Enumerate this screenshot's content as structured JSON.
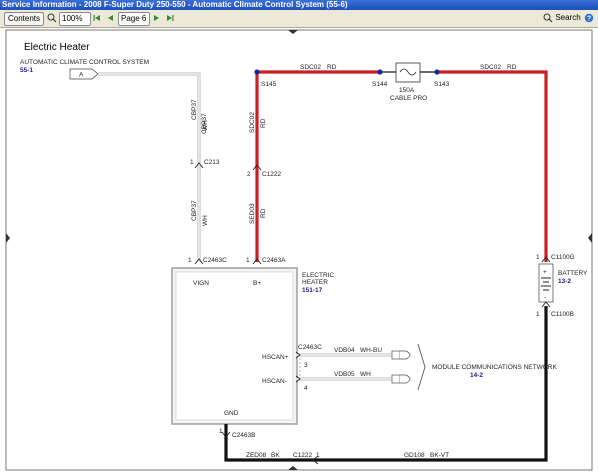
{
  "window": {
    "title": "Service Information - 2008 F-Super Duty 250-550 - Automatic Climate Control System (55-6)"
  },
  "toolbar": {
    "contents_label": "Contents",
    "zoom_value": "100%",
    "page_value": "Page 6",
    "search_label": "Search"
  },
  "diagram": {
    "title": "Electric Heater",
    "acc_system": {
      "name": "AUTOMATIC CLIMATE CONTROL SYSTEM",
      "ref": "55-1",
      "connector": "A"
    },
    "heater": {
      "name_line1": "ELECTRIC",
      "name_line2": "HEATER",
      "ref": "151-17",
      "pin_vign": "VIGN",
      "pin_bplus": "B+",
      "pin_hscan_plus": "HSCAN+",
      "pin_hscan_minus": "HSCAN-",
      "pin_gnd": "GND"
    },
    "battery": {
      "name": "BATTERY",
      "ref": "13-2",
      "plus": "+",
      "minus": "-"
    },
    "module_net": {
      "name": "MODULE COMMUNICATIONS NETWORK",
      "ref": "14-2"
    },
    "fuse": {
      "line1": "150A",
      "line2": "CABLE PRO"
    },
    "splices": {
      "s145": "S145",
      "s144": "S144",
      "s143": "S143"
    },
    "connectors": {
      "c213": "C213",
      "c213_pin": "1",
      "c1222": "C1222",
      "c1222_pin": "2",
      "c2463c_a": "C2463C",
      "c2463c_a_pin": "1",
      "c2463a": "C2463A",
      "c2463a_pin": "1",
      "c1100g": "C1100G",
      "c1100g_pin": "1",
      "c1100b": "C1100B",
      "c1100b_pin": "1",
      "c2463c_b": "C2463C",
      "c2463c_b_pin3": "3",
      "c2463c_b_pin4": "4",
      "c2463b": "C2463B",
      "c2463b_pin": "1",
      "c1222_b": "C1222",
      "c1222_b_pin": "1"
    },
    "wires": {
      "sdc02_top1": "SDC02",
      "sdc02_top1_color": "RD",
      "sdc02_top2": "SDC02",
      "sdc02_top2_color": "RD",
      "sdc02_v": "SDC02",
      "sdc02_v_color": "RD",
      "sed03": "SED03",
      "sed03_color": "RD",
      "cbp37_top": "CBP37",
      "cbp37_top_color": "WH",
      "cbp37_bot": "CBP37",
      "cbp37_bot_color": "WH",
      "vdb04": "VDB04",
      "vdb04_color": "WH-BU",
      "vdb05": "VDB05",
      "vdb05_color": "WH",
      "zed08": "ZED08",
      "zed08_color": "BK",
      "gd108": "GD108",
      "gd108_color": "BK-VT"
    },
    "colors": {
      "power_wire": "#cc1f1f",
      "ground_wire": "#111111",
      "signal_wire": "#b8b8b8"
    }
  }
}
